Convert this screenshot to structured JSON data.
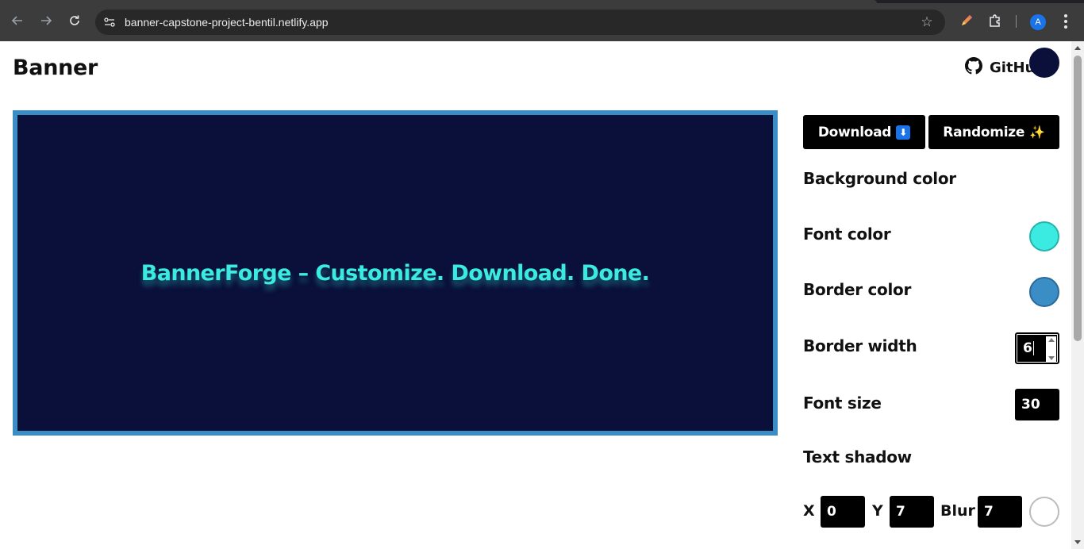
{
  "browser": {
    "url": "banner-capstone-project-bentil.netlify.app",
    "profile_initial": "A",
    "icons": [
      "back-arrow-icon",
      "forward-arrow-icon",
      "reload-icon",
      "site-info-icon",
      "bookmark-star-icon",
      "pen-extension-icon",
      "puzzle-extensions-icon",
      "kebab-menu-icon"
    ]
  },
  "header": {
    "title": "Banner",
    "github_label": "GitHub"
  },
  "banner": {
    "text": "BannerForge – Customize. Download. Done.",
    "background_color": "#0a1039",
    "font_color": "#3bebe1",
    "border_color": "#3b8dc5",
    "border_width": "6",
    "font_size": "30",
    "shadow_x": "0",
    "shadow_y": "7",
    "shadow_blur": "7"
  },
  "controls": {
    "download_label": "Download",
    "download_badge": "⬇",
    "randomize_label": "Randomize",
    "randomize_badge": "✨",
    "background_color_label": "Background color",
    "font_color_label": "Font color",
    "border_color_label": "Border color",
    "border_width_label": "Border width",
    "font_size_label": "Font size",
    "text_shadow_label": "Text shadow",
    "x_label": "X",
    "y_label": "Y",
    "blur_label": "Blur",
    "swatch_outline": {
      "background": "#0a1039",
      "font": "#25b3ac",
      "border": "#2a6a98",
      "shadow": "#bdbdbd"
    },
    "shadow_color": "#ffffff"
  }
}
